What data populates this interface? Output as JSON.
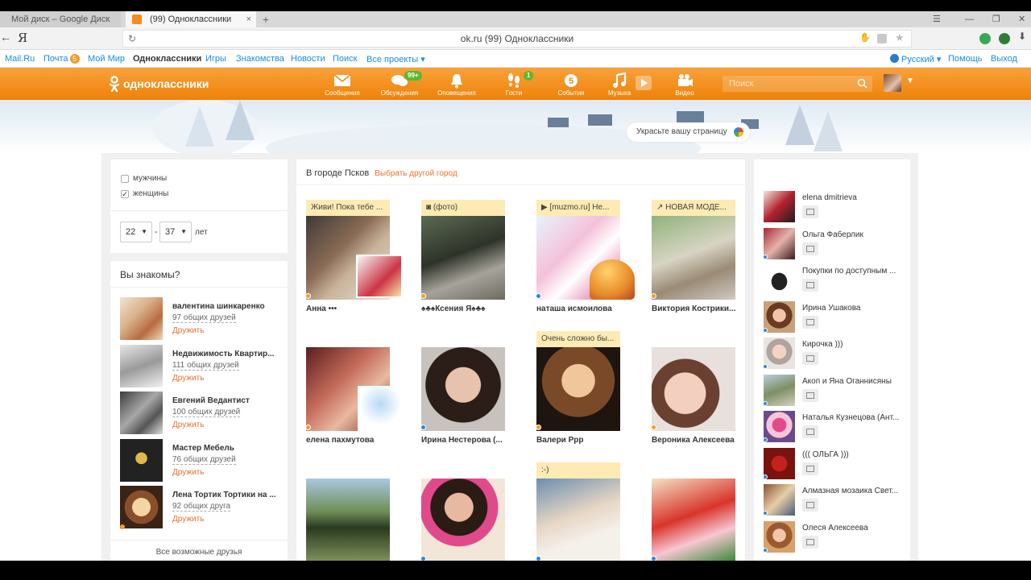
{
  "browser": {
    "tabs": [
      {
        "label": "Мой диск – Google Диск"
      },
      {
        "label": "(99) Одноклассники"
      }
    ],
    "address": "ok.ru  (99) Одноклассники",
    "yandex_glyph": "Я"
  },
  "portal": {
    "links": [
      "Mail.Ru",
      "Почта",
      "Мой Мир",
      "Одноклассники",
      "Игры",
      "Знакомства",
      "Новости",
      "Поиск",
      "Все проекты ▾"
    ],
    "mail_badge": "5",
    "language": "Русский ▾",
    "help": "Помощь",
    "logout": "Выход"
  },
  "header": {
    "logo_text": "одноклассники",
    "nav": [
      {
        "label": "Сообщения",
        "icon": "envelope-icon",
        "count": ""
      },
      {
        "label": "Обсуждения",
        "icon": "chat-bubbles-icon",
        "count": "99+"
      },
      {
        "label": "Оповещения",
        "icon": "bell-icon",
        "count": ""
      },
      {
        "label": "Гости",
        "icon": "footprints-icon",
        "count": "1"
      },
      {
        "label": "События",
        "icon": "events-icon",
        "count": ""
      },
      {
        "label": "Музыка",
        "icon": "music-note-icon",
        "count": ""
      },
      {
        "label": "Видео",
        "icon": "video-camera-icon",
        "count": ""
      }
    ],
    "search_placeholder": "Поиск",
    "accent": "#f7931e"
  },
  "banner": {
    "decorate_label": "Украсьте вашу страницу"
  },
  "filters": {
    "gender": [
      {
        "label": "мужчины",
        "checked": false
      },
      {
        "label": "женщины",
        "checked": true
      }
    ],
    "age_from": "22",
    "age_to": "37",
    "age_sep": "-",
    "age_unit": "лет"
  },
  "know": {
    "title": "Вы знакомы?",
    "items": [
      {
        "name": "валентина шинкаренко",
        "mutual": "97 общих друзей",
        "action": "Дружить"
      },
      {
        "name": "Недвижимость Квартир...",
        "mutual": "111 общих друзей",
        "action": "Дружить"
      },
      {
        "name": "Евгений Ведантист",
        "mutual": "100 общих друзей",
        "action": "Дружить"
      },
      {
        "name": "Мастер Мебель",
        "mutual": "76 общих друзей",
        "action": "Дружить"
      },
      {
        "name": "Лена Тортик Тортики на ...",
        "mutual": "92 общих друга",
        "action": "Дружить"
      }
    ],
    "all_link": "Все возможные друзья"
  },
  "city": {
    "title": "В городе Псков",
    "change": "Выбрать другой город",
    "people": [
      {
        "caption": "Живи! Пока тебе ...",
        "name": "Анна •••",
        "status": "orange"
      },
      {
        "caption": "(фото)",
        "name": "♠♣♠Ксения Я♠♣♠",
        "status": "orange"
      },
      {
        "caption": "[muzmo.ru] Не...",
        "name": "наташа исмоилова",
        "status": "blue"
      },
      {
        "caption": "НОВАЯ МОДЕ...",
        "name": "Виктория Кострики...",
        "status": "orange"
      },
      {
        "caption": "",
        "name": "елена пахмутова",
        "status": "orange"
      },
      {
        "caption": "",
        "name": "Ирина Нестерова (...",
        "status": "blue"
      },
      {
        "caption": "Очень сложно бы...",
        "name": "Валери Ррр",
        "status": "orange"
      },
      {
        "caption": "",
        "name": "Вероника Алексеева",
        "status": "orange"
      },
      {
        "caption": "",
        "name": "",
        "status": "blue"
      },
      {
        "caption": "",
        "name": "",
        "status": "blue"
      },
      {
        "caption": ":-)",
        "name": "",
        "status": "blue"
      },
      {
        "caption": "",
        "name": "",
        "status": "blue"
      }
    ]
  },
  "online": {
    "friends": [
      {
        "name": "elena dmitrieva",
        "status": "none"
      },
      {
        "name": "Ольга Фаберлик",
        "status": "blue"
      },
      {
        "name": "Покупки по доступным ...",
        "status": "none"
      },
      {
        "name": "Ирина Ушакова",
        "status": "blue"
      },
      {
        "name": "Кирочка )))",
        "status": "blue"
      },
      {
        "name": "Акоп и Яна Оганнисяны",
        "status": "blue"
      },
      {
        "name": "Наталья Кузнецова (Ант...",
        "status": "blue"
      },
      {
        "name": "((( ОЛЬГА )))",
        "status": "blue"
      },
      {
        "name": "Алмазная мозаика Свет...",
        "status": "blue"
      },
      {
        "name": "Олеся Алексеева",
        "status": "blue"
      }
    ]
  }
}
